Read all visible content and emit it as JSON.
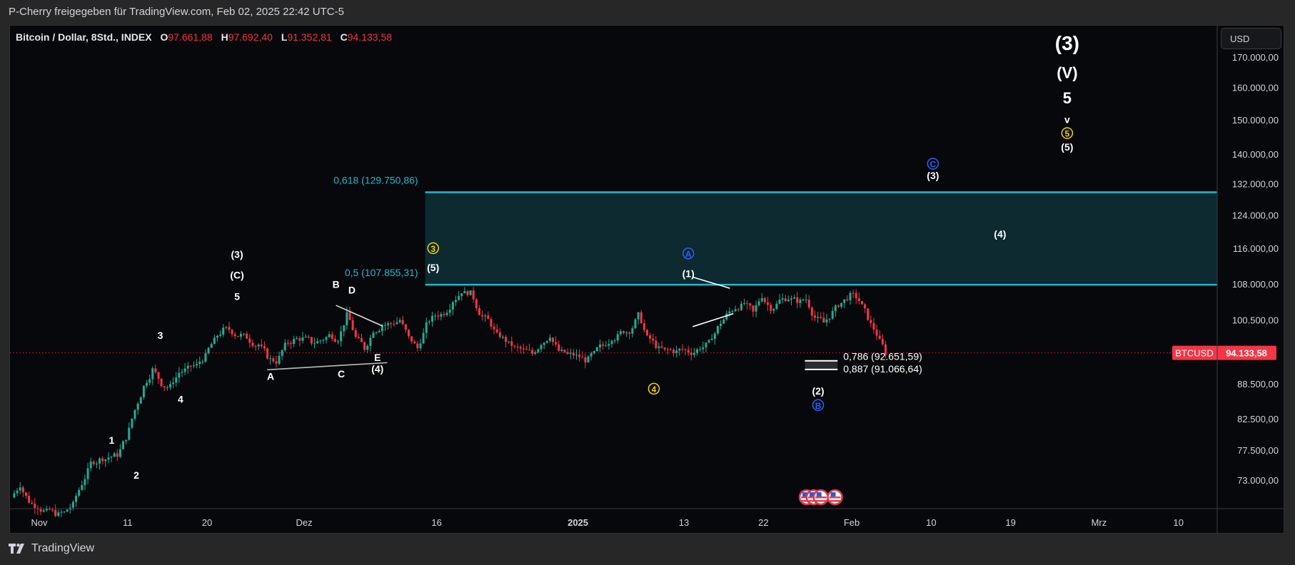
{
  "header": {
    "share_text": "P-Cherry freigegeben für TradingView.com, Feb 02, 2025 22:42 UTC-5"
  },
  "legend": {
    "symbol": "Bitcoin / Dollar, 8Std., INDEX",
    "open_label": "O",
    "open": "97.661,88",
    "high_label": "H",
    "high": "97.692,40",
    "low_label": "L",
    "low": "91.352,81",
    "close_label": "C",
    "close": "94.133,58"
  },
  "price_axis": {
    "currency_button": "USD"
  },
  "footer": {
    "brand": "TradingView",
    "logo_icon": "tradingview-logo-icon"
  },
  "colors": {
    "up": "#22ab94",
    "down": "#f23645",
    "fib": "#22b8cf",
    "fib_zone": "#0c2a30",
    "wave_yellow": "#f5d300",
    "wave_blue": "#2962ff",
    "text": "#ffffff"
  },
  "chart_data": {
    "type": "candlestick",
    "title": "Bitcoin / Dollar, 8Std., INDEX",
    "timeframe": "8h",
    "scale": "log",
    "ylim": [
      68000,
      180000
    ],
    "y_ticks": [
      170000,
      160000,
      150000,
      140000,
      132000,
      124000,
      116000,
      108000,
      100500,
      88500,
      82500,
      77500,
      73000
    ],
    "y_tick_labels": [
      "170.000,00",
      "160.000,00",
      "150.000,00",
      "140.000,00",
      "132.000,00",
      "124.000,00",
      "116.000,00",
      "108.000,00",
      "100.500,00",
      "88.500,00",
      "82.500,00",
      "77.500,00",
      "73.000,00"
    ],
    "x_ticks": [
      {
        "label": "Nov",
        "day": 0,
        "bold": false
      },
      {
        "label": "11",
        "day": 10,
        "bold": false
      },
      {
        "label": "20",
        "day": 19,
        "bold": false
      },
      {
        "label": "Dez",
        "day": 30,
        "bold": false
      },
      {
        "label": "16",
        "day": 45,
        "bold": false
      },
      {
        "label": "2025",
        "day": 61,
        "bold": true
      },
      {
        "label": "13",
        "day": 73,
        "bold": false
      },
      {
        "label": "22",
        "day": 82,
        "bold": false
      },
      {
        "label": "Feb",
        "day": 92,
        "bold": false
      },
      {
        "label": "10",
        "day": 101,
        "bold": false
      },
      {
        "label": "19",
        "day": 110,
        "bold": false
      },
      {
        "label": "Mrz",
        "day": 120,
        "bold": false
      },
      {
        "label": "10",
        "day": 129,
        "bold": false
      }
    ],
    "last_price": {
      "symbol": "BTCUSD",
      "value": 94133.58,
      "label": "94.133,58"
    },
    "price_path": [
      [
        -3.5,
        70500
      ],
      [
        -2.5,
        72300
      ],
      [
        -1.5,
        70000
      ],
      [
        -0.5,
        69200
      ],
      [
        0.5,
        68600
      ],
      [
        1.5,
        68300
      ],
      [
        2.5,
        68400
      ],
      [
        3.5,
        69500
      ],
      [
        4.5,
        72500
      ],
      [
        5.5,
        75500
      ],
      [
        6.5,
        76000
      ],
      [
        7.5,
        76400
      ],
      [
        8.5,
        76800
      ],
      [
        9.5,
        79500
      ],
      [
        10.5,
        84000
      ],
      [
        11.5,
        88000
      ],
      [
        12.5,
        91000
      ],
      [
        13.5,
        88500
      ],
      [
        14.5,
        88000
      ],
      [
        15.5,
        90500
      ],
      [
        16.5,
        91200
      ],
      [
        17.5,
        91800
      ],
      [
        18.5,
        93500
      ],
      [
        19.5,
        96500
      ],
      [
        20.5,
        98500
      ],
      [
        21.5,
        98200
      ],
      [
        22.5,
        97500
      ],
      [
        23.5,
        96500
      ],
      [
        24.5,
        95700
      ],
      [
        25.5,
        93500
      ],
      [
        26.5,
        92500
      ],
      [
        27.5,
        95500
      ],
      [
        28.5,
        96500
      ],
      [
        29.5,
        96800
      ],
      [
        30.5,
        96200
      ],
      [
        31.5,
        96500
      ],
      [
        32.5,
        97500
      ],
      [
        33.5,
        96800
      ],
      [
        34.5,
        101500
      ],
      [
        35.5,
        97000
      ],
      [
        36.5,
        95000
      ],
      [
        37.5,
        98500
      ],
      [
        38.5,
        99500
      ],
      [
        39.5,
        99800
      ],
      [
        40.5,
        100500
      ],
      [
        41.5,
        97000
      ],
      [
        42.5,
        95000
      ],
      [
        43.5,
        99500
      ],
      [
        44.5,
        101500
      ],
      [
        45.5,
        102000
      ],
      [
        46.5,
        104500
      ],
      [
        47.5,
        106500
      ],
      [
        48.5,
        106000
      ],
      [
        49.5,
        102000
      ],
      [
        50.5,
        100500
      ],
      [
        51.5,
        97500
      ],
      [
        52.5,
        96500
      ],
      [
        53.5,
        95000
      ],
      [
        54.5,
        94500
      ],
      [
        55.5,
        94000
      ],
      [
        56.5,
        96000
      ],
      [
        57.5,
        97500
      ],
      [
        58.5,
        94500
      ],
      [
        59.5,
        93800
      ],
      [
        60.5,
        93500
      ],
      [
        61.5,
        92800
      ],
      [
        62.5,
        94000
      ],
      [
        63.5,
        95500
      ],
      [
        64.5,
        97000
      ],
      [
        65.5,
        98000
      ],
      [
        66.5,
        98400
      ],
      [
        67.5,
        101500
      ],
      [
        68.5,
        97000
      ],
      [
        69.5,
        95500
      ],
      [
        70.5,
        94500
      ],
      [
        71.5,
        94500
      ],
      [
        72.5,
        94800
      ],
      [
        73.5,
        94200
      ],
      [
        74.5,
        95200
      ],
      [
        75.5,
        96000
      ],
      [
        76.5,
        99000
      ],
      [
        77.5,
        101500
      ],
      [
        78.5,
        103000
      ],
      [
        79.5,
        104000
      ],
      [
        80.5,
        102000
      ],
      [
        81.5,
        105500
      ],
      [
        82.5,
        103000
      ],
      [
        83.5,
        104500
      ],
      [
        84.5,
        105000
      ],
      [
        85.5,
        104500
      ],
      [
        86.5,
        104800
      ],
      [
        87.5,
        101000
      ],
      [
        88.5,
        100000
      ],
      [
        89.5,
        102000
      ],
      [
        90.5,
        104000
      ],
      [
        91.5,
        105500
      ],
      [
        92.5,
        104500
      ],
      [
        93.5,
        101000
      ],
      [
        94.5,
        97700
      ],
      [
        95.5,
        94133
      ]
    ],
    "fib_levels": [
      {
        "ratio": "0,618",
        "price": 129750.86,
        "label": "0,618 (129.750,86)"
      },
      {
        "ratio": "0,5",
        "price": 107855.31,
        "label": "0,5 (107.855,31)"
      },
      {
        "ratio": "0,786",
        "price": 92651.59,
        "label": "0,786 (92.651,59)"
      },
      {
        "ratio": "0,887",
        "price": 91066.64,
        "label": "0,887 (91.066,64)"
      }
    ],
    "wave_labels": [
      {
        "text": "1",
        "day": 8.2,
        "price": 78500,
        "style": "white"
      },
      {
        "text": "2",
        "day": 11.0,
        "price": 73200,
        "style": "white"
      },
      {
        "text": "3",
        "day": 13.7,
        "price": 96800,
        "style": "white"
      },
      {
        "text": "4",
        "day": 16.0,
        "price": 85200,
        "style": "white"
      },
      {
        "text": "(3)",
        "day": 22.4,
        "price": 113800,
        "style": "white"
      },
      {
        "text": "(C)",
        "day": 22.4,
        "price": 109200,
        "style": "white"
      },
      {
        "text": "5",
        "day": 22.4,
        "price": 104600,
        "style": "white"
      },
      {
        "text": "A",
        "day": 26.2,
        "price": 89200,
        "style": "white"
      },
      {
        "text": "B",
        "day": 33.6,
        "price": 107200,
        "style": "white"
      },
      {
        "text": "D",
        "day": 35.4,
        "price": 106000,
        "style": "white"
      },
      {
        "text": "C",
        "day": 34.2,
        "price": 89600,
        "style": "white"
      },
      {
        "text": "E",
        "day": 38.3,
        "price": 92600,
        "style": "white"
      },
      {
        "text": "(4)",
        "day": 38.3,
        "price": 90500,
        "style": "white"
      },
      {
        "text": "3",
        "day": 44.6,
        "price": 115200,
        "style": "yellow-circle"
      },
      {
        "text": "(5)",
        "day": 44.6,
        "price": 110800,
        "style": "white"
      },
      {
        "text": "4",
        "day": 69.6,
        "price": 87000,
        "style": "yellow-circle"
      },
      {
        "text": "A",
        "day": 73.5,
        "price": 114000,
        "style": "blue-circle"
      },
      {
        "text": "(1)",
        "day": 73.5,
        "price": 109500,
        "style": "white"
      },
      {
        "text": "(2)",
        "day": 88.2,
        "price": 86600,
        "style": "white"
      },
      {
        "text": "B",
        "day": 88.2,
        "price": 84200,
        "style": "blue-circle"
      },
      {
        "text": "C",
        "day": 101.2,
        "price": 136400,
        "style": "blue-circle"
      },
      {
        "text": "(3)",
        "day": 101.2,
        "price": 133200,
        "style": "white"
      },
      {
        "text": "(4)",
        "day": 108.8,
        "price": 118500,
        "style": "white"
      },
      {
        "text": "(3)",
        "day": 116.4,
        "price": 172500,
        "style": "white-xl"
      },
      {
        "text": "(V)",
        "day": 116.4,
        "price": 163000,
        "style": "white-lg"
      },
      {
        "text": "5",
        "day": 116.4,
        "price": 155000,
        "style": "white-lg"
      },
      {
        "text": "v",
        "day": 116.4,
        "price": 149000,
        "style": "white"
      },
      {
        "text": "5",
        "day": 116.4,
        "price": 145000,
        "style": "yellow-circle"
      },
      {
        "text": "(5)",
        "day": 116.4,
        "price": 141000,
        "style": "white"
      }
    ],
    "trendlines": [
      {
        "from": [
          25.8,
          91000
        ],
        "to": [
          39.4,
          92300
        ],
        "color": "#bbbbbb"
      },
      {
        "from": [
          33.6,
          103500
        ],
        "to": [
          38.9,
          99300
        ],
        "color": "#dddddd"
      },
      {
        "from": [
          74.0,
          109500
        ],
        "to": [
          78.2,
          107100
        ],
        "color": "#ffffff"
      },
      {
        "from": [
          74.0,
          99200
        ],
        "to": [
          78.6,
          101800
        ],
        "color": "#ffffff"
      }
    ],
    "fib_zone": {
      "from_day": 43.7,
      "top": 129750.86,
      "bottom": 107855.31
    },
    "retrace_box": {
      "from_day": 86.7,
      "to_day": 90.4,
      "top": 92651.59,
      "bottom": 91066.64
    },
    "events": {
      "day_range": [
        86.5,
        92.5
      ],
      "count": 4,
      "icon": "us-flag-icon"
    }
  }
}
